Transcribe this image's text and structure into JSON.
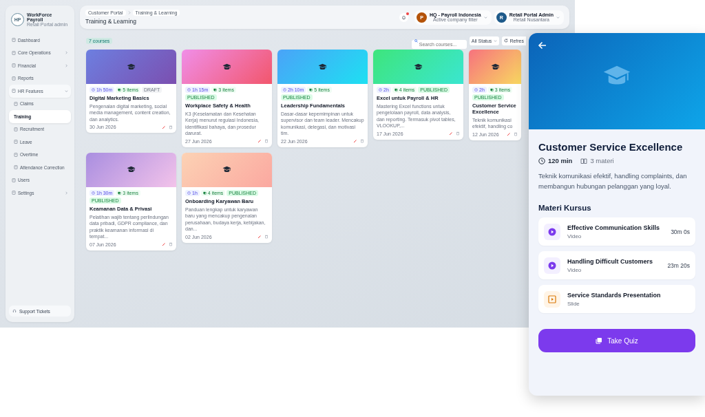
{
  "sidebar": {
    "logo_text": "HP",
    "app_name": "WorkForce Payroll",
    "app_subtitle": "Retail Portal admin",
    "items": [
      {
        "label": "Dashboard",
        "selected": false
      },
      {
        "label": "Core Operations",
        "selected": false,
        "expanded": false
      },
      {
        "label": "Financial",
        "selected": false,
        "expanded": false
      },
      {
        "label": "Reports",
        "selected": false
      },
      {
        "label": "HR Features",
        "selected": false,
        "expanded": true,
        "children": [
          {
            "label": "Claims",
            "selected": false
          },
          {
            "label": "Training",
            "selected": true
          },
          {
            "label": "Recruitment",
            "selected": false
          },
          {
            "label": "Leave",
            "selected": false
          },
          {
            "label": "Overtime",
            "selected": false
          },
          {
            "label": "Attendance Correction",
            "selected": false
          }
        ]
      },
      {
        "label": "Users",
        "selected": false
      },
      {
        "label": "Settings",
        "selected": false,
        "expanded": false
      }
    ],
    "footer_button": "Support Tickets"
  },
  "header": {
    "breadcrumbs": [
      "Customer Portal",
      "Training & Learning"
    ],
    "title": "Training & Learning",
    "notifications_unread": true,
    "company": {
      "avatar": "P",
      "name": "HQ - Payroll Indonesia",
      "caption": "Active company filter"
    },
    "user": {
      "avatar": "R",
      "name": "Retail Portal Admin",
      "caption": "Retail Nusantara"
    }
  },
  "toolbar": {
    "count": "7 courses",
    "search": {
      "placeholder": "Search courses..."
    },
    "status_filter": "All Status",
    "refresh": "Refres"
  },
  "courses": [
    {
      "title": "Digital Marketing Basics",
      "duration": "1h 50m",
      "items": "5 items",
      "status": "DRAFT",
      "published": false,
      "description": "Pengenalan digital marketing, social media management, content creation, dan analytics.",
      "date": "30 Jun 2026"
    },
    {
      "title": "Workplace Safety & Health",
      "duration": "1h 15m",
      "items": "3 items",
      "status": "PUBLISHED",
      "published": true,
      "description": "K3 (Keselamatan dan Kesehatan Kerja) menurut regulasi Indonesia, identifikasi bahaya, dan prosedur darurat.",
      "date": "27 Jun 2026"
    },
    {
      "title": "Leadership Fundamentals",
      "duration": "2h 10m",
      "items": "5 items",
      "status": "PUBLISHED",
      "published": true,
      "description": "Dasar-dasar kepemimpinan untuk supervisor dan team leader. Mencakup komunikasi, delegasi, dan motivasi tim.",
      "date": "22 Jun 2026"
    },
    {
      "title": "Excel untuk Payroll & HR",
      "duration": "2h",
      "items": "4 items",
      "status": "PUBLISHED",
      "published": true,
      "description": "Mastering Excel functions untuk pengelolaan payroll, data analysis, dan reporting. Termasuk pivot tables, VLOOKUP,...",
      "date": "17 Jun 2026"
    },
    {
      "title": "Customer Service Excellence",
      "duration": "2h",
      "items": "3 items",
      "status": "PUBLISHED",
      "published": true,
      "description": "Teknik komunikasi efektif, handling co",
      "date": "12 Jun 2026"
    },
    {
      "title": "Keamanan Data & Privasi",
      "duration": "1h 30m",
      "items": "3 items",
      "status": "PUBLISHED",
      "published": true,
      "description": "Pelatihan wajib tentang perlindungan data pribadi, GDPR compliance, dan praktik keamanan informasi di tempat...",
      "date": "07 Jun 2026"
    },
    {
      "title": "Onboarding Karyawan Baru",
      "duration": "1h",
      "items": "4 items",
      "status": "PUBLISHED",
      "published": true,
      "description": "Panduan lengkap untuk karyawan baru yang mencakup pengenalan perusahaan, budaya kerja, kebijakan, dan...",
      "date": "02 Jun 2026"
    }
  ],
  "detail": {
    "title": "Customer Service Excellence",
    "duration": "120 min",
    "materials_count": "3 materi",
    "description": "Teknik komunikasi efektif, handling complaints, dan membangun hubungan pelanggan yang loyal.",
    "section_title": "Materi Kursus",
    "materials": [
      {
        "title": "Effective Communication Skills",
        "type": "Video",
        "kind": "video",
        "length": "30m 0s"
      },
      {
        "title": "Handling Difficult Customers",
        "type": "Video",
        "kind": "video",
        "length": "23m 20s"
      },
      {
        "title": "Service Standards Presentation",
        "type": "Slide",
        "kind": "slide"
      }
    ],
    "quiz_button": "Take Quiz"
  }
}
